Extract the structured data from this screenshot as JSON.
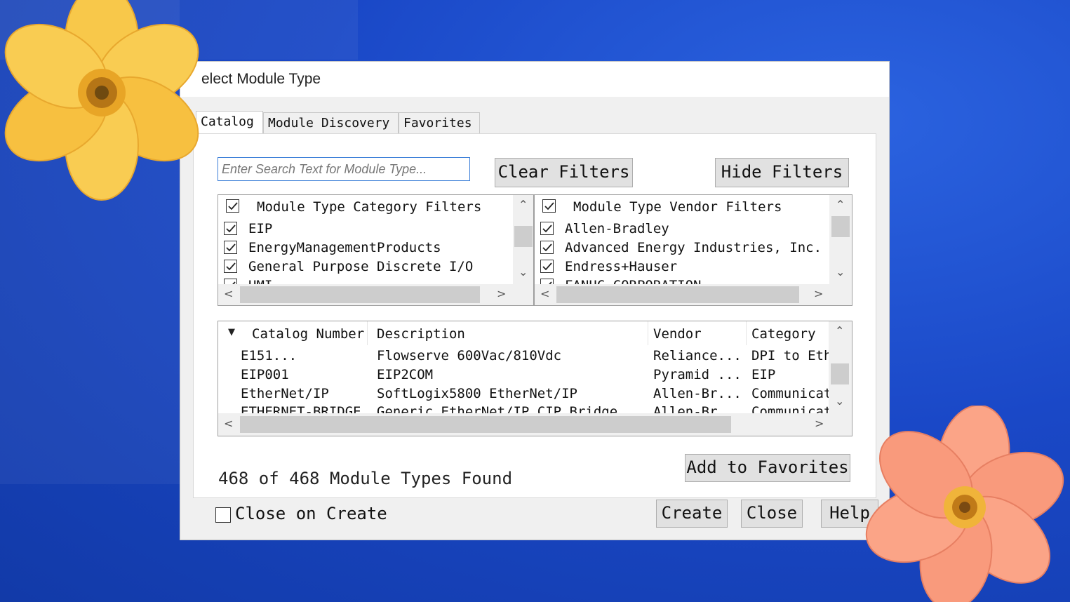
{
  "dialog": {
    "title": "elect Module Type"
  },
  "tabs": [
    {
      "label": "Catalog",
      "active": true
    },
    {
      "label": "Module Discovery",
      "active": false
    },
    {
      "label": "Favorites",
      "active": false
    }
  ],
  "search": {
    "placeholder": "Enter Search Text for Module Type..."
  },
  "buttons": {
    "clear_filters": "Clear Filters",
    "hide_filters": "Hide Filters",
    "add_to_favorites": "Add to Favorites",
    "create": "Create",
    "close": "Close",
    "help": "Help"
  },
  "category_filters": {
    "header": "Module Type Category Filters",
    "items": [
      "EIP",
      "EnergyManagementProducts",
      "General Purpose Discrete I/O",
      "HMI"
    ]
  },
  "vendor_filters": {
    "header": "Module Type Vendor Filters",
    "items": [
      "Allen-Bradley",
      "Advanced Energy Industries, Inc.",
      "Endress+Hauser",
      "FANUC CORPORATION"
    ]
  },
  "table": {
    "columns": [
      "Catalog Number",
      "Description",
      "Vendor",
      "Category"
    ],
    "rows": [
      [
        "E151...",
        "Flowserve 600Vac/810Vdc",
        "Reliance...",
        "DPI to Eth"
      ],
      [
        "EIP001",
        "EIP2COM",
        "Pyramid ...",
        "EIP"
      ],
      [
        "EtherNet/IP",
        "SoftLogix5800 EtherNet/IP",
        "Allen-Br...",
        "Communicat"
      ],
      [
        "ETHERNET-BRIDGE",
        "Generic EtherNet/IP CIP Bridge",
        "Allen-Br...",
        "Communicat"
      ]
    ]
  },
  "status": {
    "found": "468 of 468 Module Types Found"
  },
  "close_on_create": {
    "label": "Close on Create",
    "checked": false
  },
  "colors": {
    "desktop": "#1a48c7",
    "search_border": "#3c7fd8",
    "flower_yellow": "#f7c646",
    "flower_pink": "#f9a07f"
  }
}
